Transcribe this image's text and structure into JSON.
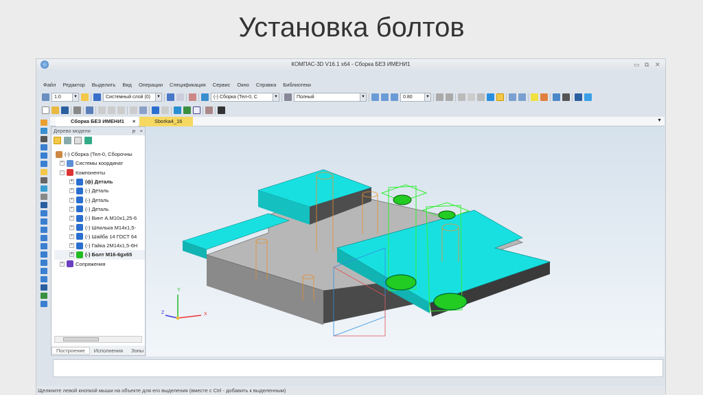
{
  "slide_title": "Установка болтов",
  "window": {
    "title": "КОМПАС-3D V16.1 x64 - Сборка БЕЗ ИМЕНИ1"
  },
  "menu": [
    "Файл",
    "Редактор",
    "Выделить",
    "Вид",
    "Операции",
    "Спецификация",
    "Сервис",
    "Окно",
    "Справка",
    "Библиотеки"
  ],
  "toolbar": {
    "step": "1.0",
    "layer": "Системный слой (0)",
    "object": "(-) Сборка (Тел-0, С",
    "view_mode": "Полный",
    "zoom": "0.80"
  },
  "tabs": [
    {
      "label": "Сборка БЕЗ ИМЕНИ1",
      "close": "×"
    },
    {
      "label": "Sborka4_16"
    }
  ],
  "tree": {
    "title": "Дерево модели",
    "pin": "ᵽ",
    "close": "×",
    "items": [
      {
        "label": "(-) Сборка (Тел-0, Сборочны",
        "color": "#c84"
      },
      {
        "label": "Системы координат",
        "color": "#5b8fd6"
      },
      {
        "label": "Компоненты",
        "color": "#d33"
      },
      {
        "label": "(ф) Деталь",
        "color": "#2a6fd0"
      },
      {
        "label": "(-) Деталь",
        "color": "#2a6fd0"
      },
      {
        "label": "(-) Деталь",
        "color": "#2a6fd0"
      },
      {
        "label": "(-) Деталь",
        "color": "#2a6fd0"
      },
      {
        "label": "(-) Винт А.М10х1,25-6",
        "color": "#2a6fd0"
      },
      {
        "label": "(-) Шпилька М14х1,5-",
        "color": "#2a6fd0"
      },
      {
        "label": "(-) Шайба 14 ГОСТ 64",
        "color": "#2a6fd0"
      },
      {
        "label": "(-) Гайка 2М14х1,5-6Н",
        "color": "#2a6fd0"
      },
      {
        "label": "(-) Болт М16-6gх65",
        "color": "#2b2"
      },
      {
        "label": "Сопряжения",
        "color": "#6a3fc0"
      }
    ],
    "bottom_tabs": [
      "Построение",
      "Исполнения",
      "Зоны"
    ]
  },
  "axes": {
    "x": "X",
    "y": "Y",
    "z": "Z"
  },
  "status": "Щелкните левой кнопкой мыши на объекте для его выделения (вместе с Ctrl - добавить к выделенным)",
  "colors": {
    "cyan": "#19e0e0",
    "green": "#22cc22",
    "grey": "#b5b5b5"
  }
}
